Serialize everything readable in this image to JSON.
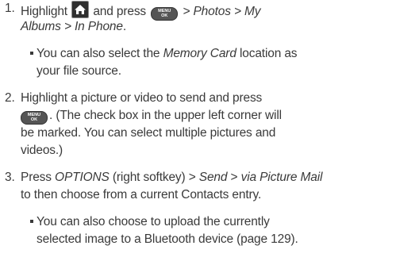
{
  "steps": [
    {
      "number": "1.",
      "line1_pre": "Highlight",
      "home_icon": "home-icon",
      "line1_mid": "and press",
      "menu_key": {
        "top": "MENU",
        "bottom": "OK"
      },
      "line1_post": "> Photos > My",
      "line2": "Albums > In Phone",
      "line2_end": ".",
      "bullet": {
        "line1_pre": "You can also select the ",
        "line1_it": "Memory Card",
        "line1_post": " location as",
        "line2": "your file source."
      }
    },
    {
      "number": "2.",
      "line1": "Highlight a picture or video to send and press",
      "line2_post": ". (The check box in the upper left corner will",
      "line3": "be marked. You can select multiple pictures and",
      "line4": "videos.)"
    },
    {
      "number": "3.",
      "line1_pre": "Press ",
      "line1_it1": "OPTIONS",
      "line1_mid": " (right softkey) > ",
      "line1_it2": "Send",
      "line1_sep": " > ",
      "line1_it3": "via Picture Mail",
      "line2": "to then choose from a current Contacts entry.",
      "bullet": {
        "line1": "You can also choose to upload the currently",
        "line2": "selected image to a Bluetooth device (page 129)."
      }
    }
  ]
}
